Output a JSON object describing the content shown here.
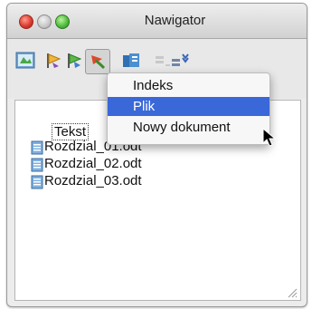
{
  "window": {
    "title": "Nawigator"
  },
  "toolbar": {
    "buttons": [
      {
        "icon": "navigator-toggle-icon"
      },
      {
        "icon": "navigation-back-icon"
      },
      {
        "icon": "navigation-forward-icon"
      },
      {
        "icon": "drag-mode-icon"
      },
      {
        "icon": "headings-icon"
      },
      {
        "icon": "promote-chapter-icon"
      },
      {
        "icon": "demote-chapter-icon"
      }
    ]
  },
  "menu": {
    "items": [
      {
        "label": "Indeks",
        "selected": false
      },
      {
        "label": "Plik",
        "selected": true
      },
      {
        "label": "Nowy dokument",
        "selected": false
      }
    ]
  },
  "tree": {
    "root": "Tekst",
    "items": [
      "Rozdzial_01.odt",
      "Rozdzial_02.odt",
      "Rozdzial_03.odt"
    ]
  }
}
